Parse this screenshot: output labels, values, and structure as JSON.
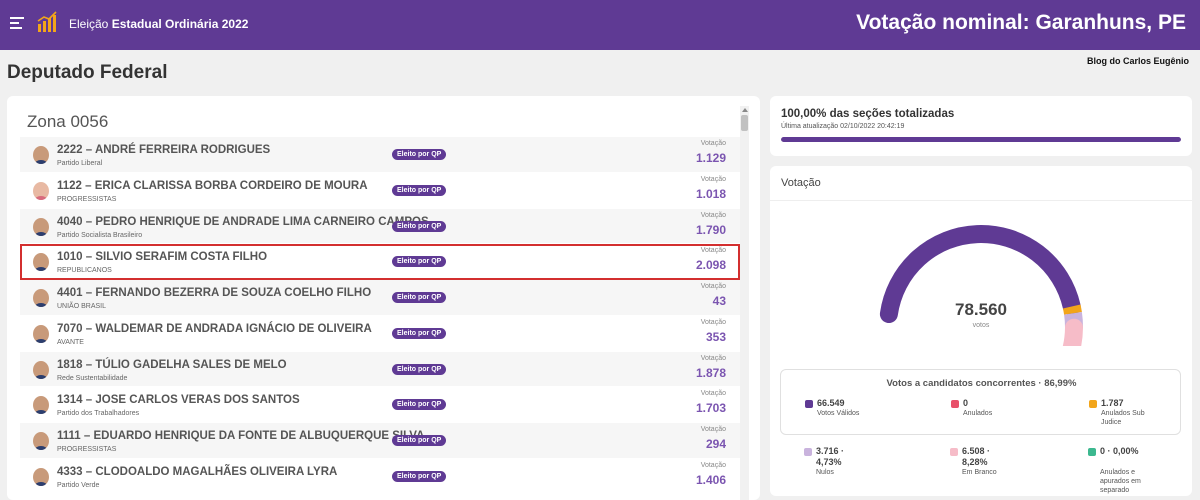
{
  "header": {
    "app_title_prefix": "Eleição ",
    "app_title_bold": "Estadual Ordinária 2022",
    "page_heading": "Votação nominal: Garanhuns, PE"
  },
  "office_title": "Deputado Federal",
  "blog_label": "Blog do Carlos Eugênio",
  "zone": {
    "title": "Zona 0056",
    "candidates": [
      {
        "name": "2222 – ANDRÉ FERREIRA RODRIGUES",
        "party": "Partido Liberal",
        "status": "Eleito por QP",
        "votes_label": "Votação",
        "votes": "1.129"
      },
      {
        "name": "1122 – ERICA CLARISSA BORBA CORDEIRO DE MOURA",
        "party": "PROGRESSISTAS",
        "status": "Eleito por QP",
        "votes_label": "Votação",
        "votes": "1.018"
      },
      {
        "name": "4040 – PEDRO HENRIQUE DE ANDRADE LIMA CARNEIRO CAMPOS",
        "party": "Partido Socialista Brasileiro",
        "status": "Eleito por QP",
        "votes_label": "Votação",
        "votes": "1.790"
      },
      {
        "name": "1010 – SILVIO SERAFIM COSTA FILHO",
        "party": "REPUBLICANOS",
        "status": "Eleito por QP",
        "votes_label": "Votação",
        "votes": "2.098"
      },
      {
        "name": "4401 – FERNANDO BEZERRA DE SOUZA COELHO FILHO",
        "party": "UNIÃO BRASIL",
        "status": "Eleito por QP",
        "votes_label": "Votação",
        "votes": "43"
      },
      {
        "name": "7070 – WALDEMAR DE ANDRADA IGNÁCIO DE OLIVEIRA",
        "party": "AVANTE",
        "status": "Eleito por QP",
        "votes_label": "Votação",
        "votes": "353"
      },
      {
        "name": "1818 – TÚLIO GADELHA SALES DE MELO",
        "party": "Rede Sustentabilidade",
        "status": "Eleito por QP",
        "votes_label": "Votação",
        "votes": "1.878"
      },
      {
        "name": "1314 – JOSE CARLOS VERAS DOS SANTOS",
        "party": "Partido dos Trabalhadores",
        "status": "Eleito por QP",
        "votes_label": "Votação",
        "votes": "1.703"
      },
      {
        "name": "1111 – EDUARDO HENRIQUE DA FONTE DE ALBUQUERQUE SILVA",
        "party": "PROGRESSISTAS",
        "status": "Eleito por QP",
        "votes_label": "Votação",
        "votes": "294"
      },
      {
        "name": "4333 – CLODOALDO MAGALHÃES OLIVEIRA LYRA",
        "party": "Partido Verde",
        "status": "Eleito por QP",
        "votes_label": "Votação",
        "votes": "1.406"
      }
    ]
  },
  "progress": {
    "title": "100,00% das seções totalizadas",
    "updated": "Última atualização 02/10/2022 20:42:19",
    "percent": 100
  },
  "votacao": {
    "title": "Votação",
    "total": "78.560",
    "unit": "votos",
    "legend_head": "Votos a candidatos concorrentes · 86,99%",
    "legend": [
      {
        "value": "66.549",
        "label": "Votos Válidos",
        "color": "#5f3a94"
      },
      {
        "value": "0",
        "label": "Anulados",
        "color": "#e8506a"
      },
      {
        "value": "1.787",
        "label": "Anulados Sub Judice",
        "color": "#f2a51a"
      },
      {
        "value": "3.716 · 4,73%",
        "label": "Nulos",
        "color": "#c9b3dd"
      },
      {
        "value": "6.508 · 8,28%",
        "label": "Em Branco",
        "color": "#f6bcc8"
      },
      {
        "value": "0 · 0,00%",
        "label": "Anulados e apurados em separado",
        "color": "#3cb88f"
      }
    ],
    "gauge_segments": [
      {
        "name": "Votos Válidos",
        "value": 66549,
        "color": "#5f3a94"
      },
      {
        "name": "Anulados Sub Judice",
        "value": 1787,
        "color": "#f2a51a"
      },
      {
        "name": "Nulos",
        "value": 3716,
        "color": "#c9b3dd"
      },
      {
        "name": "Em Branco",
        "value": 6508,
        "color": "#f6bcc8"
      }
    ]
  }
}
